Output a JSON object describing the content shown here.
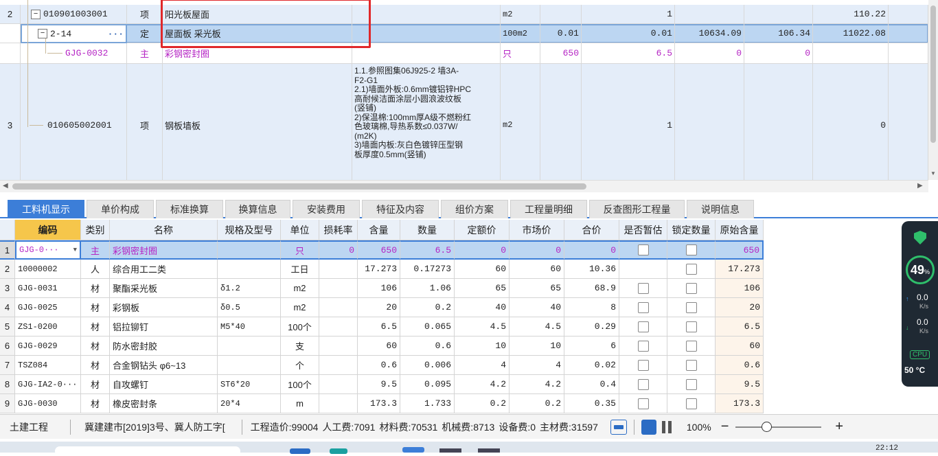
{
  "top_rows": [
    {
      "num": "2",
      "code": "010901003001",
      "kind": "项",
      "name": "阳光板屋面",
      "feature": "",
      "unit": "m2",
      "qty1": "",
      "qty2": "1",
      "price": "",
      "rate": "",
      "total": "110.22",
      "expand": "−"
    },
    {
      "num": "",
      "code": "2-14",
      "kind": "定",
      "name": "屋面板 采光板",
      "feature": "",
      "unit": "100m2",
      "qty1": "0.01",
      "qty2": "0.01",
      "price": "10634.09",
      "rate": "106.34",
      "total": "11022.08",
      "expand": "−",
      "more": "···"
    },
    {
      "num": "",
      "code": "GJG-0032",
      "kind": "主",
      "name": "彩钢密封圈",
      "feature": "",
      "unit": "只",
      "qty1": "650",
      "qty2": "6.5",
      "price": "0",
      "rate": "0",
      "total": ""
    },
    {
      "num": "3",
      "code": "010605002001",
      "kind": "项",
      "name": "钢板墙板",
      "feature_lines": [
        "1.1.参照图集06J925-2  墙3A-",
        "F2-G1",
        "2.1)墙面外板:0.6mm镀铝锌HPC",
        "高耐候洁面涂层小圆浪波纹板",
        "(竖铺)",
        "2)保温棉:100mm厚A级不燃粉红",
        "色玻璃棉,导热系数≤0.037W/",
        "(m2K)",
        "3)墙面内板:灰白色镀锌压型钢",
        "板厚度0.5mm(竖铺)"
      ],
      "unit": "m2",
      "qty1": "",
      "qty2": "1",
      "price": "",
      "rate": "",
      "total": "0"
    }
  ],
  "tabs": [
    "工料机显示",
    "单价构成",
    "标准换算",
    "换算信息",
    "安装费用",
    "特征及内容",
    "组价方案",
    "工程量明细",
    "反查图形工程量",
    "说明信息"
  ],
  "columns": [
    "",
    "编码",
    "类别",
    "名称",
    "规格及型号",
    "单位",
    "损耗率",
    "含量",
    "数量",
    "定额价",
    "市场价",
    "合价",
    "是否暂估",
    "锁定数量",
    "原始含量"
  ],
  "rows": [
    {
      "n": "1",
      "code": "GJG-0···",
      "type": "主",
      "name": "彩钢密封圈",
      "spec": "",
      "unit": "只",
      "loss": "0",
      "content": "650",
      "qty": "6.5",
      "quota": "0",
      "market": "0",
      "sum": "0",
      "temp": true,
      "lock": true,
      "orig": "650"
    },
    {
      "n": "2",
      "code": "10000002",
      "type": "人",
      "name": "综合用工二类",
      "spec": "",
      "unit": "工日",
      "loss": "",
      "content": "17.273",
      "qty": "0.17273",
      "quota": "60",
      "market": "60",
      "sum": "10.36",
      "temp": false,
      "lock": true,
      "orig": "17.273"
    },
    {
      "n": "3",
      "code": "GJG-0031",
      "type": "材",
      "name": "聚酯采光板",
      "spec": "δ1.2",
      "unit": "m2",
      "loss": "",
      "content": "106",
      "qty": "1.06",
      "quota": "65",
      "market": "65",
      "sum": "68.9",
      "temp": true,
      "lock": true,
      "orig": "106"
    },
    {
      "n": "4",
      "code": "GJG-0025",
      "type": "材",
      "name": "彩钢板",
      "spec": "δ0.5",
      "unit": "m2",
      "loss": "",
      "content": "20",
      "qty": "0.2",
      "quota": "40",
      "market": "40",
      "sum": "8",
      "temp": true,
      "lock": true,
      "orig": "20"
    },
    {
      "n": "5",
      "code": "ZS1-0200",
      "type": "材",
      "name": "铝拉铆钉",
      "spec": "M5*40",
      "unit": "100个",
      "loss": "",
      "content": "6.5",
      "qty": "0.065",
      "quota": "4.5",
      "market": "4.5",
      "sum": "0.29",
      "temp": true,
      "lock": true,
      "orig": "6.5"
    },
    {
      "n": "6",
      "code": "GJG-0029",
      "type": "材",
      "name": "防水密封胶",
      "spec": "",
      "unit": "支",
      "loss": "",
      "content": "60",
      "qty": "0.6",
      "quota": "10",
      "market": "10",
      "sum": "6",
      "temp": true,
      "lock": true,
      "orig": "60"
    },
    {
      "n": "7",
      "code": "TSZ084",
      "type": "材",
      "name": "合金钢钻头 φ6~13",
      "spec": "",
      "unit": "个",
      "loss": "",
      "content": "0.6",
      "qty": "0.006",
      "quota": "4",
      "market": "4",
      "sum": "0.02",
      "temp": true,
      "lock": true,
      "orig": "0.6"
    },
    {
      "n": "8",
      "code": "GJG-IA2-0···",
      "type": "材",
      "name": "自攻螺钉",
      "spec": "ST6*20",
      "unit": "100个",
      "loss": "",
      "content": "9.5",
      "qty": "0.095",
      "quota": "4.2",
      "market": "4.2",
      "sum": "0.4",
      "temp": true,
      "lock": true,
      "orig": "9.5"
    },
    {
      "n": "9",
      "code": "GJG-0030",
      "type": "材",
      "name": "橡皮密封条",
      "spec": "20*4",
      "unit": "m",
      "loss": "",
      "content": "173.3",
      "qty": "1.733",
      "quota": "0.2",
      "market": "0.2",
      "sum": "0.35",
      "temp": true,
      "lock": true,
      "orig": "173.3"
    }
  ],
  "status": {
    "project": "土建工程",
    "doc": "冀建建市[2019]3号、冀人防工字[",
    "cost": "工程造价:99004",
    "labor": "人工费:7091",
    "material": "材料费:70531",
    "machine": "机械费:8713",
    "equip": "设备费:0",
    "main": "主材费:31597",
    "zoom": "100%"
  },
  "widget": {
    "percent": "49",
    "pct_sign": "%",
    "up": "0.0",
    "down": "0.0",
    "unit": "K/s",
    "cpu": "CPU",
    "temp": "50 °C"
  },
  "clock": "22:12",
  "colors": {
    "accent": "#3c7ed8",
    "selected_row": "#bcd6f2",
    "magenta": "#b524c4",
    "highlight_box": "#e0282a"
  }
}
